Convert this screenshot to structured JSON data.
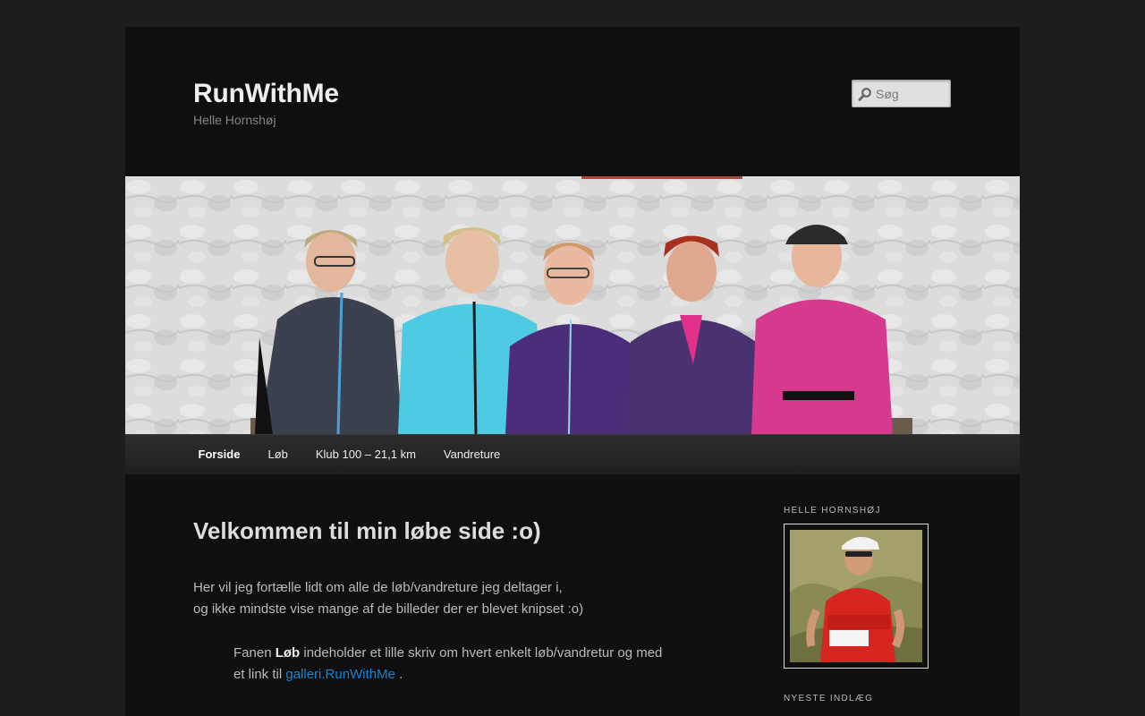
{
  "site": {
    "title": "RunWithMe",
    "description": "Helle Hornshøj"
  },
  "search": {
    "placeholder": "Søg",
    "icon": "search-icon"
  },
  "nav": {
    "items": [
      {
        "label": "Forside",
        "current": true
      },
      {
        "label": "Løb"
      },
      {
        "label": "Klub 100 – 21,1 km"
      },
      {
        "label": "Vandreture"
      }
    ]
  },
  "entry": {
    "title": "Velkommen til min løbe side :o)",
    "intro_line1": "Her vil jeg fortælle lidt om alle de løb/vandreture jeg deltager i,",
    "intro_line2": "og ikke mindste vise mange af de billeder der er blevet knipset :o)",
    "fanen_prefix": "Fanen ",
    "fanen_bold": "Løb",
    "fanen_rest": " indeholder et lille skriv om hvert enkelt løb/vandretur og med",
    "fanen_line2_prefix": "et link til ",
    "gallery_link": "galleri.RunWithMe",
    "fanen_line2_suffix": " ."
  },
  "sidebar": {
    "profile_title": "HELLE HORNSHØJ",
    "recent_title": "NYESTE INDLÆG"
  },
  "colors": {
    "page_bg": "#0f0f0f",
    "outer_bg": "#1d1d1d",
    "link": "#1982d1"
  }
}
